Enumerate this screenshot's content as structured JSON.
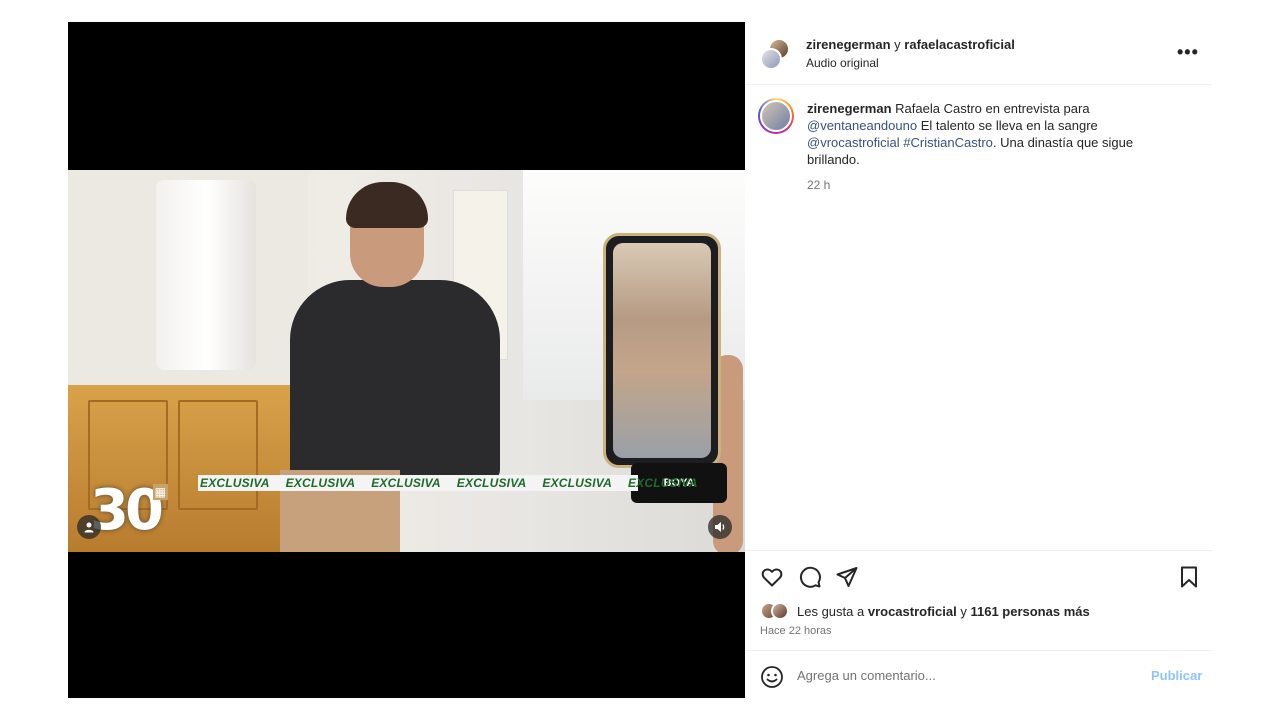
{
  "video": {
    "ticker_items": [
      "EXCLUSIVA",
      "EXCLUSIVA",
      "EXCLUSIVA",
      "EXCLUSIVA",
      "EXCLUSIVA",
      "EXCLUSIVA"
    ],
    "badge": "30",
    "mic_brand": "BOYA"
  },
  "header": {
    "user1": "zirenegerman",
    "conjunction": "y",
    "user2": "rafaelacastroficial",
    "audio": "Audio original",
    "more": "•••"
  },
  "caption": {
    "username": "zirenegerman",
    "text1": "Rafaela Castro en entrevista para",
    "mention1": "@ventaneandouno",
    "text2": "El talento se lleva en la sangre",
    "mention2": "@vrocastroficial",
    "hashtag": "#CristianCastro",
    "text3": ". Una dinastía que sigue brillando.",
    "time": "22 h"
  },
  "likes": {
    "prefix": "Les gusta a",
    "user": "vrocastroficial",
    "conj": "y",
    "count": "1161 personas más",
    "ago": "Hace 22 horas"
  },
  "comment": {
    "placeholder": "Agrega un comentario...",
    "publish": "Publicar"
  },
  "icons": [
    "heart-icon",
    "comment-icon",
    "share-icon",
    "bookmark-icon",
    "emoji-icon",
    "user-tag-icon",
    "volume-icon",
    "more-icon"
  ]
}
